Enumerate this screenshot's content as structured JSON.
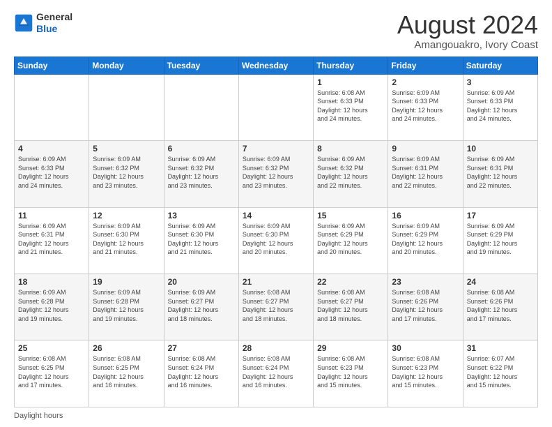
{
  "logo": {
    "general": "General",
    "blue": "Blue"
  },
  "title": "August 2024",
  "subtitle": "Amangouakro, Ivory Coast",
  "headers": [
    "Sunday",
    "Monday",
    "Tuesday",
    "Wednesday",
    "Thursday",
    "Friday",
    "Saturday"
  ],
  "weeks": [
    [
      {
        "day": "",
        "info": ""
      },
      {
        "day": "",
        "info": ""
      },
      {
        "day": "",
        "info": ""
      },
      {
        "day": "",
        "info": ""
      },
      {
        "day": "1",
        "info": "Sunrise: 6:08 AM\nSunset: 6:33 PM\nDaylight: 12 hours\nand 24 minutes."
      },
      {
        "day": "2",
        "info": "Sunrise: 6:09 AM\nSunset: 6:33 PM\nDaylight: 12 hours\nand 24 minutes."
      },
      {
        "day": "3",
        "info": "Sunrise: 6:09 AM\nSunset: 6:33 PM\nDaylight: 12 hours\nand 24 minutes."
      }
    ],
    [
      {
        "day": "4",
        "info": "Sunrise: 6:09 AM\nSunset: 6:33 PM\nDaylight: 12 hours\nand 24 minutes."
      },
      {
        "day": "5",
        "info": "Sunrise: 6:09 AM\nSunset: 6:32 PM\nDaylight: 12 hours\nand 23 minutes."
      },
      {
        "day": "6",
        "info": "Sunrise: 6:09 AM\nSunset: 6:32 PM\nDaylight: 12 hours\nand 23 minutes."
      },
      {
        "day": "7",
        "info": "Sunrise: 6:09 AM\nSunset: 6:32 PM\nDaylight: 12 hours\nand 23 minutes."
      },
      {
        "day": "8",
        "info": "Sunrise: 6:09 AM\nSunset: 6:32 PM\nDaylight: 12 hours\nand 22 minutes."
      },
      {
        "day": "9",
        "info": "Sunrise: 6:09 AM\nSunset: 6:31 PM\nDaylight: 12 hours\nand 22 minutes."
      },
      {
        "day": "10",
        "info": "Sunrise: 6:09 AM\nSunset: 6:31 PM\nDaylight: 12 hours\nand 22 minutes."
      }
    ],
    [
      {
        "day": "11",
        "info": "Sunrise: 6:09 AM\nSunset: 6:31 PM\nDaylight: 12 hours\nand 21 minutes."
      },
      {
        "day": "12",
        "info": "Sunrise: 6:09 AM\nSunset: 6:30 PM\nDaylight: 12 hours\nand 21 minutes."
      },
      {
        "day": "13",
        "info": "Sunrise: 6:09 AM\nSunset: 6:30 PM\nDaylight: 12 hours\nand 21 minutes."
      },
      {
        "day": "14",
        "info": "Sunrise: 6:09 AM\nSunset: 6:30 PM\nDaylight: 12 hours\nand 20 minutes."
      },
      {
        "day": "15",
        "info": "Sunrise: 6:09 AM\nSunset: 6:29 PM\nDaylight: 12 hours\nand 20 minutes."
      },
      {
        "day": "16",
        "info": "Sunrise: 6:09 AM\nSunset: 6:29 PM\nDaylight: 12 hours\nand 20 minutes."
      },
      {
        "day": "17",
        "info": "Sunrise: 6:09 AM\nSunset: 6:29 PM\nDaylight: 12 hours\nand 19 minutes."
      }
    ],
    [
      {
        "day": "18",
        "info": "Sunrise: 6:09 AM\nSunset: 6:28 PM\nDaylight: 12 hours\nand 19 minutes."
      },
      {
        "day": "19",
        "info": "Sunrise: 6:09 AM\nSunset: 6:28 PM\nDaylight: 12 hours\nand 19 minutes."
      },
      {
        "day": "20",
        "info": "Sunrise: 6:09 AM\nSunset: 6:27 PM\nDaylight: 12 hours\nand 18 minutes."
      },
      {
        "day": "21",
        "info": "Sunrise: 6:08 AM\nSunset: 6:27 PM\nDaylight: 12 hours\nand 18 minutes."
      },
      {
        "day": "22",
        "info": "Sunrise: 6:08 AM\nSunset: 6:27 PM\nDaylight: 12 hours\nand 18 minutes."
      },
      {
        "day": "23",
        "info": "Sunrise: 6:08 AM\nSunset: 6:26 PM\nDaylight: 12 hours\nand 17 minutes."
      },
      {
        "day": "24",
        "info": "Sunrise: 6:08 AM\nSunset: 6:26 PM\nDaylight: 12 hours\nand 17 minutes."
      }
    ],
    [
      {
        "day": "25",
        "info": "Sunrise: 6:08 AM\nSunset: 6:25 PM\nDaylight: 12 hours\nand 17 minutes."
      },
      {
        "day": "26",
        "info": "Sunrise: 6:08 AM\nSunset: 6:25 PM\nDaylight: 12 hours\nand 16 minutes."
      },
      {
        "day": "27",
        "info": "Sunrise: 6:08 AM\nSunset: 6:24 PM\nDaylight: 12 hours\nand 16 minutes."
      },
      {
        "day": "28",
        "info": "Sunrise: 6:08 AM\nSunset: 6:24 PM\nDaylight: 12 hours\nand 16 minutes."
      },
      {
        "day": "29",
        "info": "Sunrise: 6:08 AM\nSunset: 6:23 PM\nDaylight: 12 hours\nand 15 minutes."
      },
      {
        "day": "30",
        "info": "Sunrise: 6:08 AM\nSunset: 6:23 PM\nDaylight: 12 hours\nand 15 minutes."
      },
      {
        "day": "31",
        "info": "Sunrise: 6:07 AM\nSunset: 6:22 PM\nDaylight: 12 hours\nand 15 minutes."
      }
    ]
  ],
  "footer": "Daylight hours"
}
